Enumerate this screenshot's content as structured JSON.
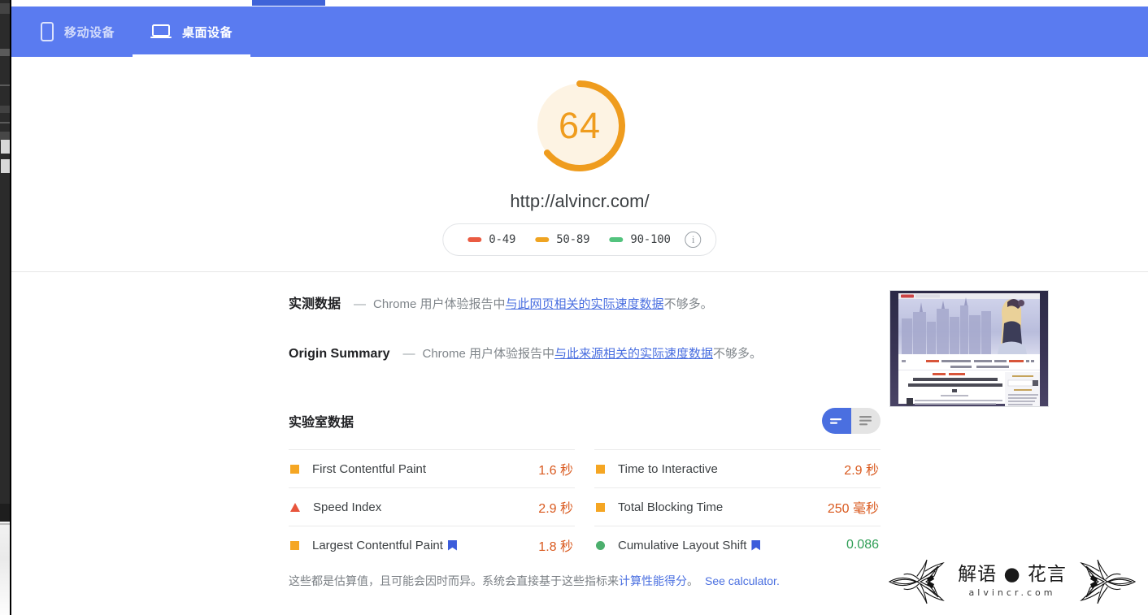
{
  "left_strip": {
    "label": "editor-gutter"
  },
  "header": {
    "tabs": [
      {
        "id": "mobile",
        "label": "移动设备",
        "icon": "phone-icon",
        "active": false
      },
      {
        "id": "desktop",
        "label": "桌面设备",
        "icon": "laptop-icon",
        "active": true
      }
    ]
  },
  "score": {
    "value": "64",
    "numeric": 64,
    "url": "http://alvincr.com/",
    "arc_color": "#ef9c1e",
    "track_color": "#fdf3e3",
    "legend": [
      {
        "range": "0-49",
        "color": "#ea5b42"
      },
      {
        "range": "50-89",
        "color": "#efa422"
      },
      {
        "range": "90-100",
        "color": "#53c37e"
      }
    ],
    "info_icon": "info-icon",
    "info_glyph": "i"
  },
  "field_data": {
    "rows": [
      {
        "title": "实测数据",
        "dash": "—",
        "pre": "Chrome 用户体验报告中",
        "link": "与此网页相关的实际速度数据",
        "post": "不够多。"
      },
      {
        "title": "Origin Summary",
        "dash": "—",
        "pre": "Chrome 用户体验报告中",
        "link": "与此来源相关的实际速度数据",
        "post": "不够多。"
      }
    ]
  },
  "thumbnail": {
    "alt": "page-screenshot-thumbnail",
    "headline1": "Determine whether the site needs to",
    "headline2": "disable Google fonts and how to disable",
    "headline3": "it"
  },
  "lab_data": {
    "title": "实验室数据",
    "toggle": {
      "options": [
        {
          "id": "compact",
          "icon": "list-compact-icon",
          "active": true
        },
        {
          "id": "expanded",
          "icon": "list-expanded-icon",
          "active": false
        }
      ]
    },
    "metrics": [
      {
        "name": "First Contentful Paint",
        "value": "1.6 秒",
        "swatch": "square",
        "status": "average",
        "badge": false
      },
      {
        "name": "Time to Interactive",
        "value": "2.9 秒",
        "swatch": "square",
        "status": "average",
        "badge": false
      },
      {
        "name": "Speed Index",
        "value": "2.9 秒",
        "swatch": "triangle",
        "status": "poor",
        "badge": false
      },
      {
        "name": "Total Blocking Time",
        "value": "250 毫秒",
        "swatch": "square",
        "status": "average",
        "badge": false
      },
      {
        "name": "Largest Contentful Paint",
        "value": "1.8 秒",
        "swatch": "square",
        "status": "average",
        "badge": true
      },
      {
        "name": "Cumulative Layout Shift",
        "value": "0.086",
        "swatch": "circle",
        "status": "good",
        "badge": true
      }
    ],
    "note": {
      "pre": "这些都是估算值，且可能会因时而异。系统会直接基于这些指标来",
      "link": "计算性能得分",
      "post": "。",
      "calculator": "See calculator."
    }
  },
  "watermark": {
    "main": "解语 ● 花言",
    "sub": "alvincr.com"
  }
}
